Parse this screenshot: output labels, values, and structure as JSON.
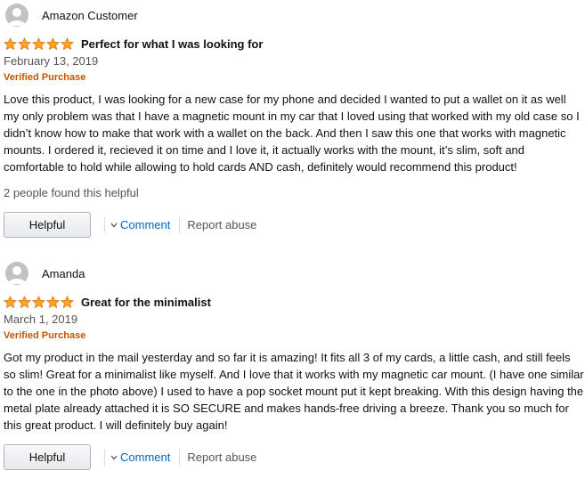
{
  "reviews": [
    {
      "author": "Amazon Customer",
      "stars": 5,
      "title": "Perfect for what I was looking for",
      "date": "February 13, 2019",
      "verified": "Verified Purchase",
      "body": "Love this product, I was looking for a new case for my phone and decided I wanted to put a wallet on it as well my only problem was that I have a magnetic mount in my car that I loved using that worked with my old case so I didn’t know how to make that work with a wallet on the back. And then I saw this one that works with magnetic mounts. I ordered it, recieved it on time and I love it, it actually works with the mount, it’s slim, soft and comfortable to hold while allowing to hold cards AND cash, definitely would recommend this product!",
      "helpful_count": "2 people found this helpful",
      "helpful_label": "Helpful",
      "comment_label": "Comment",
      "report_label": "Report abuse"
    },
    {
      "author": "Amanda",
      "stars": 5,
      "title": "Great for the minimalist",
      "date": "March 1, 2019",
      "verified": "Verified Purchase",
      "body": "Got my product in the mail yesterday and so far it is amazing! It fits all 3 of my cards, a little cash, and still feels so slim! Great for a minimalist like myself. And I love that it works with my magnetic car mount. (I have one similar to the one in the photo above) I used to have a pop socket mount put it kept breaking. With this design having the metal plate already attached it is SO SECURE and makes hands-free driving a breeze. Thank you so much for this great product. I will definitely buy again!",
      "helpful_label": "Helpful",
      "comment_label": "Comment",
      "report_label": "Report abuse"
    }
  ],
  "colors": {
    "star": "#ffa41c",
    "star_stroke": "#de7921",
    "verified": "#c45500",
    "link": "#0066c0",
    "muted": "#555555"
  },
  "icons": {
    "avatar": "default-avatar-icon",
    "star": "star-icon",
    "comment": "chevron-down-icon"
  }
}
